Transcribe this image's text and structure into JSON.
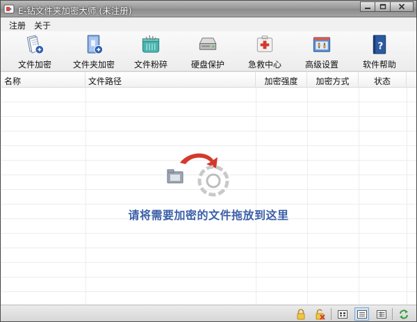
{
  "window": {
    "title": "E-钻文件夹加密大师 (未注册)",
    "controls": [
      "minimize-icon",
      "maximize-icon",
      "close-icon"
    ]
  },
  "menu": [
    "注册",
    "关于"
  ],
  "toolbar": [
    {
      "label": "文件加密",
      "icon": "file-encrypt-icon"
    },
    {
      "label": "文件夹加密",
      "icon": "folder-encrypt-icon"
    },
    {
      "label": "文件粉碎",
      "icon": "shredder-icon"
    },
    {
      "label": "硬盘保护",
      "icon": "hard-disk-icon"
    },
    {
      "label": "急救中心",
      "icon": "first-aid-icon"
    },
    {
      "label": "高级设置",
      "icon": "advanced-settings-icon"
    },
    {
      "label": "软件帮助",
      "icon": "help-book-icon"
    }
  ],
  "table": {
    "columns": [
      "名称",
      "文件路径",
      "加密强度",
      "加密方式",
      "状态"
    ],
    "rows": []
  },
  "drop_hint": "请将需要加密的文件拖放到这里",
  "statusbar": {
    "buttons": [
      "lock-icon",
      "unlock-icon",
      "large-icons-view-icon",
      "details-view-icon",
      "list-view-icon",
      "refresh-icon"
    ],
    "active": "details-view-icon"
  },
  "colors": {
    "hint_text": "#3b5fa8",
    "accent_red": "#d33a2c",
    "selection": "#cfe3f7"
  }
}
